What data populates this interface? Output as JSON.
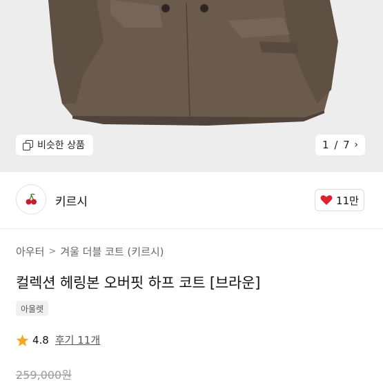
{
  "image": {
    "similar_products_label": "비슷한 상품",
    "pager": {
      "current": "1",
      "separator": "/",
      "total": "7"
    }
  },
  "brand": {
    "name": "키르시",
    "like_count": "11만"
  },
  "breadcrumb": {
    "items": [
      "아우터",
      "겨울 더블 코트 (키르시)"
    ]
  },
  "product": {
    "title": "컬렉션 헤링본 오버핏 하프 코트 [브라운]",
    "tag": "아울렛",
    "rating": "4.8",
    "reviews": "후기 11개",
    "original_price": "259,000원"
  },
  "colors": {
    "accent_red": "#e0202e",
    "star": "#f5a623",
    "coat": "#6b5b4d"
  },
  "icons": {
    "similar": "stacked-squares-icon",
    "pager_next": "chevron-right-icon",
    "like": "heart-icon",
    "rating": "star-icon",
    "brand_logo": "cherry-logo"
  }
}
